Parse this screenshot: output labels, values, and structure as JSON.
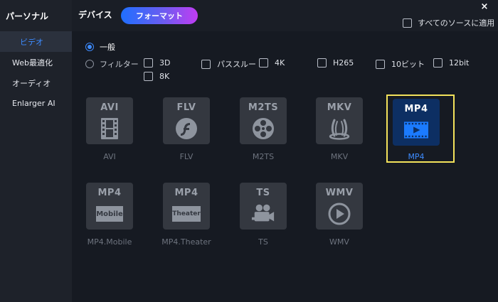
{
  "window": {
    "close_label": "×"
  },
  "header": {
    "personal_tab": "パーソナル",
    "device_tab": "デバイス",
    "format_tab": "フォーマット",
    "apply_all_label": "すべてのソースに適用"
  },
  "sidebar": {
    "items": [
      {
        "label": "ビデオ",
        "active": true
      },
      {
        "label": "Web最適化",
        "active": false
      },
      {
        "label": "オーディオ",
        "active": false
      },
      {
        "label": "Enlarger AI",
        "active": false
      }
    ]
  },
  "options": {
    "general_label": "一般",
    "filter_label": "フィルター",
    "filters": [
      {
        "label": "3D",
        "checked": false
      },
      {
        "label": "パススルー",
        "checked": false
      },
      {
        "label": "4K",
        "checked": false
      },
      {
        "label": "H265",
        "checked": false
      },
      {
        "label": "10ビット",
        "checked": false
      },
      {
        "label": "12bit",
        "checked": false
      },
      {
        "label": "8K",
        "checked": false
      }
    ]
  },
  "formats": [
    {
      "name": "AVI",
      "label": "AVI",
      "icon": "film-strip-icon",
      "selected": false
    },
    {
      "name": "FLV",
      "label": "FLV",
      "icon": "flash-icon",
      "selected": false
    },
    {
      "name": "M2TS",
      "label": "M2TS",
      "icon": "film-reel-icon",
      "selected": false
    },
    {
      "name": "MKV",
      "label": "MKV",
      "icon": "matroska-icon",
      "selected": false
    },
    {
      "name": "MP4",
      "label": "MP4",
      "icon": "video-play-icon",
      "selected": true
    },
    {
      "name": "MP4",
      "label": "MP4.Mobile",
      "icon": "mobile-badge-icon",
      "badge": "Mobile",
      "selected": false
    },
    {
      "name": "MP4",
      "label": "MP4.Theater",
      "icon": "theater-badge-icon",
      "badge": "Theater",
      "selected": false
    },
    {
      "name": "TS",
      "label": "TS",
      "icon": "video-camera-icon",
      "selected": false
    },
    {
      "name": "WMV",
      "label": "WMV",
      "icon": "play-circle-icon",
      "selected": false
    }
  ],
  "colors": {
    "accent": "#3d8bff",
    "selection_border": "#f3e25b",
    "format_tab_gradient_start": "#1f6fff",
    "format_tab_gradient_end": "#c13cf2"
  }
}
